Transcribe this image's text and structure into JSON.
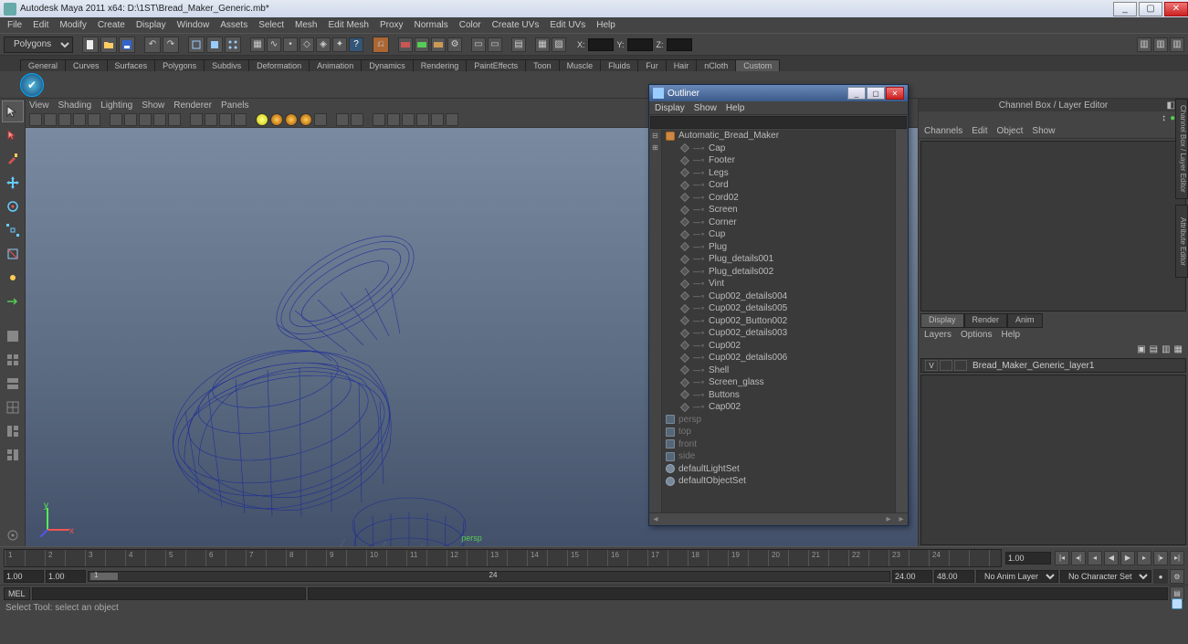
{
  "window": {
    "title": "Autodesk Maya 2011 x64: D:\\1ST\\Bread_Maker_Generic.mb*",
    "min": "_",
    "max": "▢",
    "close": "✕"
  },
  "menus": [
    "File",
    "Edit",
    "Modify",
    "Create",
    "Display",
    "Window",
    "Assets",
    "Select",
    "Mesh",
    "Edit Mesh",
    "Proxy",
    "Normals",
    "Color",
    "Create UVs",
    "Edit UVs",
    "Help"
  ],
  "mode_selector": "Polygons",
  "xform_fields": {
    "x": "X:",
    "y": "Y:",
    "z": "Z:"
  },
  "shelf_tabs": [
    "General",
    "Curves",
    "Surfaces",
    "Polygons",
    "Subdivs",
    "Deformation",
    "Animation",
    "Dynamics",
    "Rendering",
    "PaintEffects",
    "Toon",
    "Muscle",
    "Fluids",
    "Fur",
    "Hair",
    "nCloth",
    "Custom"
  ],
  "shelf_active": "Custom",
  "viewport_menus": [
    "View",
    "Shading",
    "Lighting",
    "Show",
    "Renderer",
    "Panels"
  ],
  "viewport_label": "persp",
  "side_tabs": {
    "cb": "Channel Box / Layer Editor",
    "ae": "Attribute Editor"
  },
  "channel_box": {
    "title": "Channel Box / Layer Editor",
    "tabs": [
      "Channels",
      "Edit",
      "Object",
      "Show"
    ]
  },
  "layer_editor": {
    "tabs": [
      "Display",
      "Render",
      "Anim"
    ],
    "active": "Display",
    "menu": [
      "Layers",
      "Options",
      "Help"
    ],
    "layer_vis": "V",
    "layer_name": "Bread_Maker_Generic_layer1"
  },
  "outliner": {
    "title": "Outliner",
    "menus": [
      "Display",
      "Show",
      "Help"
    ],
    "root": "Automatic_Bread_Maker",
    "children": [
      "Cap",
      "Footer",
      "Legs",
      "Cord",
      "Cord02",
      "Screen",
      "Corner",
      "Cup",
      "Plug",
      "Plug_details001",
      "Plug_details002",
      "Vint",
      "Cup002_details004",
      "Cup002_details005",
      "Cup002_Button002",
      "Cup002_details003",
      "Cup002",
      "Cup002_details006",
      "Shell",
      "Screen_glass",
      "Buttons",
      "Cap002"
    ],
    "cameras": [
      "persp",
      "top",
      "front",
      "side"
    ],
    "sets": [
      "defaultLightSet",
      "defaultObjectSet"
    ]
  },
  "timeline": {
    "ticks": [
      "1",
      "2",
      "3",
      "4",
      "5",
      "6",
      "7",
      "8",
      "9",
      "10",
      "11",
      "12",
      "13",
      "14",
      "15",
      "16",
      "17",
      "18",
      "19",
      "20",
      "21",
      "22",
      "23",
      "24"
    ]
  },
  "range": {
    "start_outer": "1.00",
    "start_inner": "1.00",
    "cur": "1",
    "mid": "24",
    "end_inner": "24.00",
    "end_outer": "48.00",
    "anim_layer": "No Anim Layer",
    "char_set": "No Character Set"
  },
  "cmd": {
    "label": "MEL"
  },
  "helpline": "Select Tool: select an object",
  "tl_end_label": "1.00"
}
